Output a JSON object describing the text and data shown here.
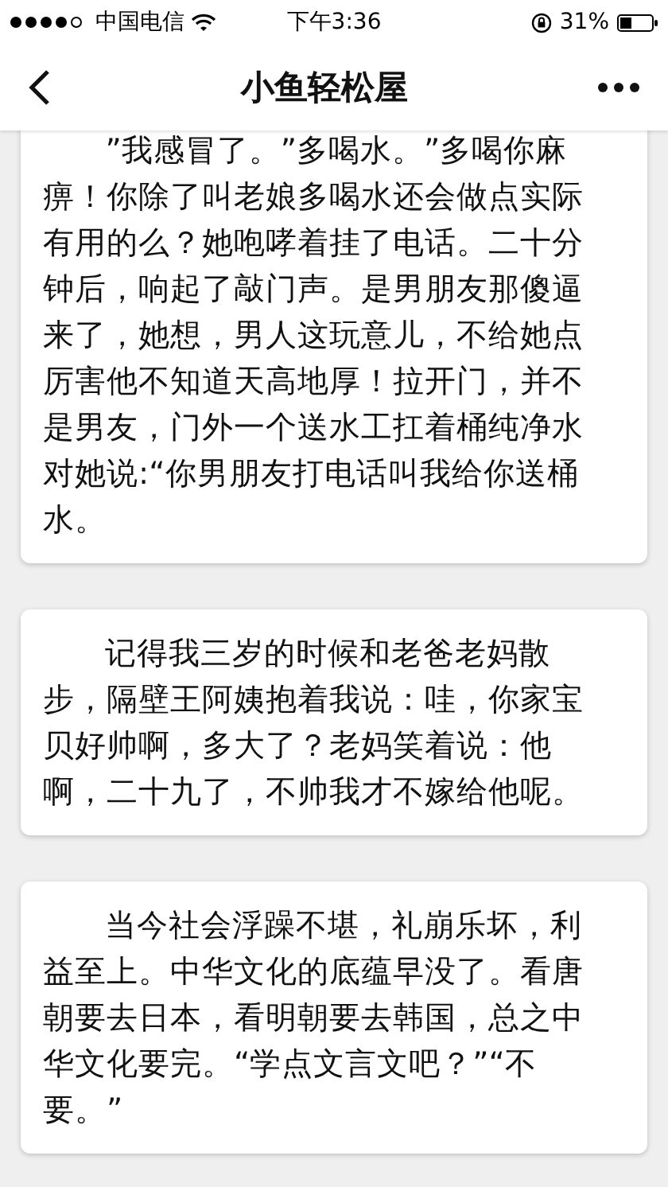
{
  "status_bar": {
    "carrier": "中国电信",
    "time": "下午3:36",
    "battery": "31%"
  },
  "nav_bar": {
    "title": "小鱼轻松屋"
  },
  "posts": [
    {
      "text": "”我感冒了。”多喝水。”多喝你麻痹！你除了叫老娘多喝水还会做点实际有用的么？她咆哮着挂了电话。二十分钟后，响起了敲门声。是男朋友那傻逼来了，她想，男人这玩意儿，不给她点厉害他不知道天高地厚！拉开门，并不是男友，门外一个送水工扛着桶纯净水对她说:“你男朋友打电话叫我给你送桶水。"
    },
    {
      "text": "记得我三岁的时候和老爸老妈散步，隔壁王阿姨抱着我说：哇，你家宝贝好帅啊，多大了？老妈笑着说：他啊，二十九了，不帅我才不嫁给他呢。"
    },
    {
      "text": "当今社会浮躁不堪，礼崩乐坏，利益至上。中华文化的底蕴早没了。看唐朝要去日本，看明朝要去韩国，总之中华文化要完。“学点文言文吧？”“不要。”"
    }
  ]
}
